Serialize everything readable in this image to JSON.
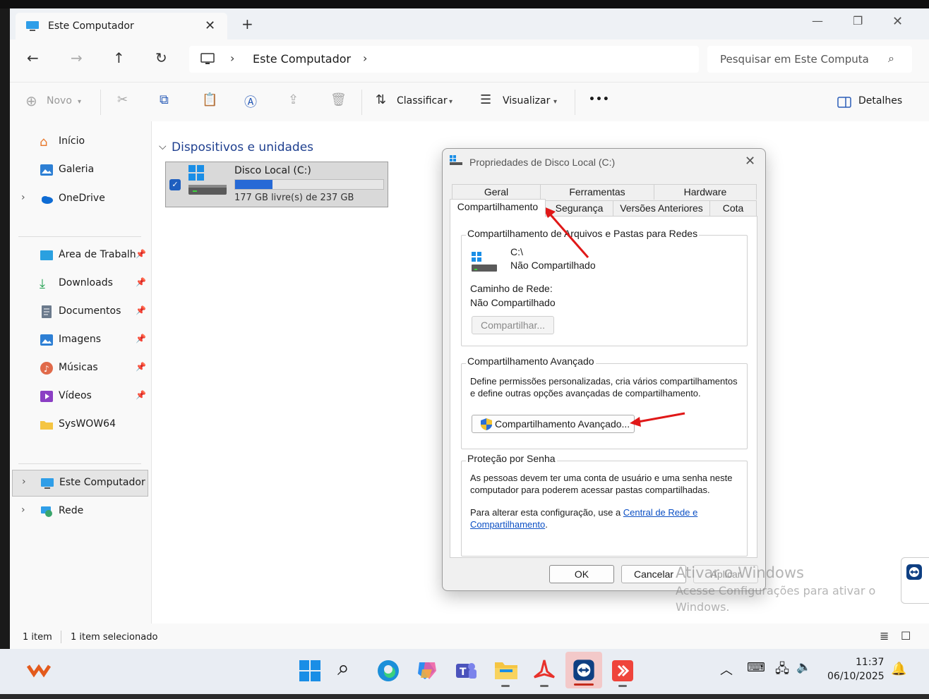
{
  "window": {
    "tab_title": "Este Computador",
    "new_tab": "+"
  },
  "nav": {
    "address": "Este Computador",
    "search_placeholder": "Pesquisar em Este Computa"
  },
  "toolbar": {
    "new_label": "Novo",
    "sort_label": "Classificar",
    "view_label": "Visualizar",
    "more_label": "•••",
    "details_label": "Detalhes"
  },
  "sidebar": {
    "items": [
      {
        "label": "Início"
      },
      {
        "label": "Galeria"
      },
      {
        "label": "OneDrive"
      },
      {
        "label": "Área de Trabalho"
      },
      {
        "label": "Downloads"
      },
      {
        "label": "Documentos"
      },
      {
        "label": "Imagens"
      },
      {
        "label": "Músicas"
      },
      {
        "label": "Vídeos"
      },
      {
        "label": "SysWOW64"
      },
      {
        "label": "Este Computador"
      },
      {
        "label": "Rede"
      }
    ]
  },
  "content": {
    "section_title": "Dispositivos e unidades",
    "drive": {
      "name": "Disco Local (C:)",
      "free_text": "177 GB livre(s) de 237 GB",
      "used_fraction": 0.253
    }
  },
  "status": {
    "count": "1 item",
    "selected": "1 item selecionado"
  },
  "dialog": {
    "title": "Propriedades de Disco Local (C:)",
    "tabs_row1": [
      "Geral",
      "Ferramentas",
      "Hardware"
    ],
    "tabs_row2": [
      "Compartilhamento",
      "Segurança",
      "Versões Anteriores",
      "Cota"
    ],
    "net_group": {
      "label": "Compartilhamento de Arquivos e Pastas para Redes",
      "path": "C:\\",
      "state": "Não Compartilhado",
      "net_path_label": "Caminho de Rede:",
      "net_path_value": "Não Compartilhado",
      "share_button": "Compartilhar..."
    },
    "adv_group": {
      "label": "Compartilhamento Avançado",
      "desc1": "Define permissões personalizadas, cria vários compartilhamentos",
      "desc2": "e define outras opções avançadas de compartilhamento.",
      "button": "Compartilhamento Avançado..."
    },
    "pwd_group": {
      "label": "Proteção por Senha",
      "desc1": "As pessoas devem ter uma conta de usuário e uma senha neste",
      "desc2": "computador para poderem acessar pastas compartilhadas.",
      "change_prefix": "Para alterar esta configuração, use a ",
      "link1": "Central de Rede e",
      "link2": "Compartilhamento",
      "suffix": "."
    },
    "ok": "OK",
    "cancel": "Cancelar",
    "apply": "Aplicar"
  },
  "watermark": {
    "line1": "Ativar o Windows",
    "line2": "Acesse Configurações para ativar o",
    "line3": "Windows."
  },
  "taskbar": {
    "time": "11:37",
    "date": "06/10/2025"
  },
  "colors": {
    "accent": "#0067c0",
    "progress": "#2669d6",
    "arrow": "#e01818"
  }
}
